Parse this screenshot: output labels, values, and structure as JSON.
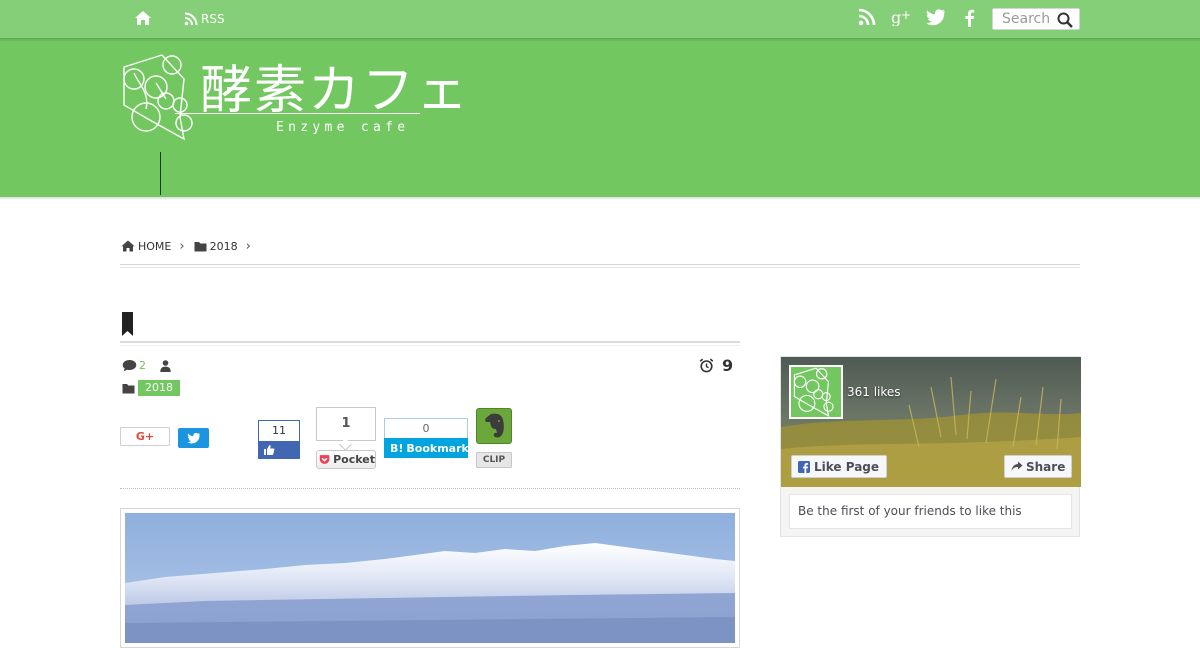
{
  "colors": {
    "topbar": "#86cf79",
    "header": "#72c760",
    "accent": "#6bc25a"
  },
  "topbar": {
    "home_icon": "home-icon",
    "rss_label": "RSS",
    "social_icons": [
      "rss-icon",
      "google-plus-icon",
      "twitter-icon",
      "facebook-icon"
    ],
    "search_placeholder": "Search"
  },
  "header": {
    "logo_title": "酵素カフェ",
    "logo_subtitle": "Enzyme cafe"
  },
  "breadcrumb": {
    "home": "HOME",
    "category": "2018",
    "separator": "›"
  },
  "article": {
    "comment_count": "2",
    "date_day": "9",
    "category": "2018"
  },
  "share": {
    "gplus_label": "G+",
    "fb_like_count": "11",
    "pocket_count": "1",
    "pocket_label": "Pocket",
    "hatena_count": "0",
    "hatena_label": "Bookmark",
    "hatena_mark": "B!",
    "evernote_label": "CLIP"
  },
  "sidebar": {
    "fb_likes": "361 likes",
    "fb_like_page": "Like Page",
    "fb_share": "Share",
    "fb_friends": "Be the first of your friends to like this"
  }
}
